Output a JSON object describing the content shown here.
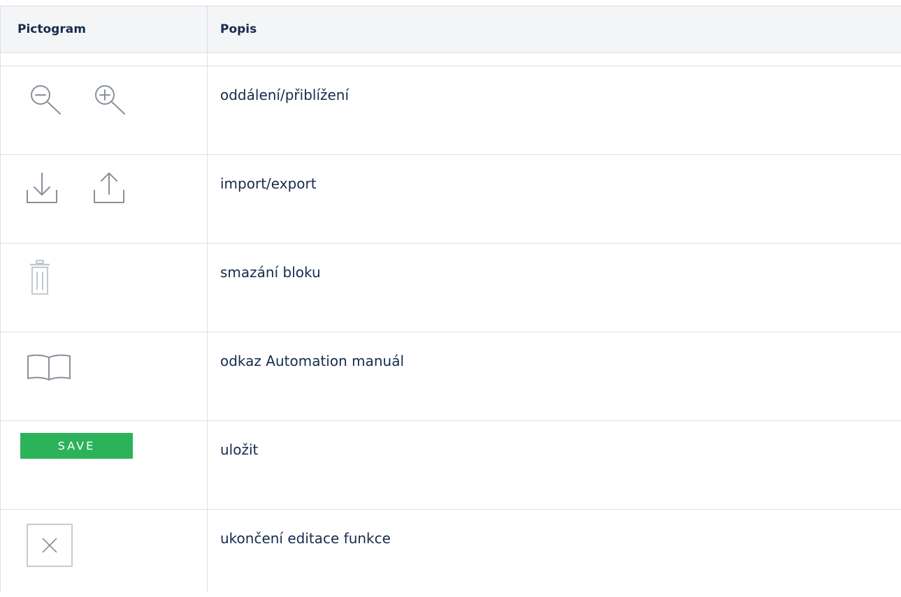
{
  "table": {
    "headers": [
      "Pictogram",
      "Popis"
    ],
    "rows": [
      {
        "icons": [
          "zoom-out-icon",
          "zoom-in-icon"
        ],
        "description": "oddálení/přiblížení"
      },
      {
        "icons": [
          "import-icon",
          "export-icon"
        ],
        "description": "import/export"
      },
      {
        "icons": [
          "trash-icon"
        ],
        "description": "smazání bloku"
      },
      {
        "icons": [
          "book-icon"
        ],
        "description": "odkaz Automation manuál"
      },
      {
        "icons": [
          "save-button"
        ],
        "button_label": "SAVE",
        "description": "uložit"
      },
      {
        "icons": [
          "close-icon"
        ],
        "description": "ukončení editace funkce"
      }
    ]
  },
  "colors": {
    "header_bg": "#f4f5f7",
    "border": "#dcdfe4",
    "text": "#172b4d",
    "icon_gray": "#8a9099",
    "save_green": "#2cb35a"
  }
}
